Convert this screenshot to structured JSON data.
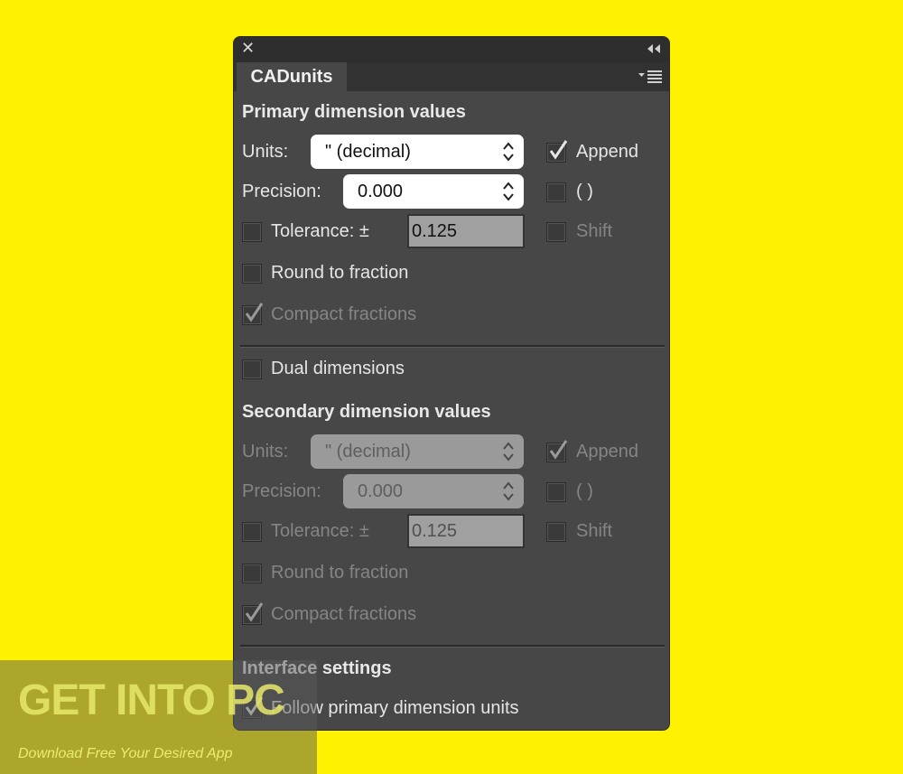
{
  "panel": {
    "tab_title": "CADunits",
    "close_glyph": "✕",
    "collapse_icon": "double-chevron-left-icon",
    "menu_icon": "panel-menu-icon"
  },
  "primary": {
    "heading": "Primary dimension values",
    "units_label": "Units:",
    "units_value": "\" (decimal)",
    "append_label": "Append",
    "append_checked": true,
    "precision_label": "Precision:",
    "precision_value": "0.000",
    "parens_label": "( )",
    "parens_checked": false,
    "tolerance_label": "Tolerance: ±",
    "tolerance_checked": false,
    "tolerance_value": "0.125",
    "shift_label": "Shift",
    "shift_checked": false,
    "round_label": "Round to fraction",
    "round_checked": false,
    "compact_label": "Compact fractions",
    "compact_checked": true
  },
  "dual": {
    "label": "Dual dimensions",
    "checked": false
  },
  "secondary": {
    "heading": "Secondary dimension values",
    "units_label": "Units:",
    "units_value": "\" (decimal)",
    "append_label": "Append",
    "append_checked": true,
    "precision_label": "Precision:",
    "precision_value": "0.000",
    "parens_label": "( )",
    "parens_checked": false,
    "tolerance_label": "Tolerance: ±",
    "tolerance_checked": false,
    "tolerance_value": "0.125",
    "shift_label": "Shift",
    "shift_checked": false,
    "round_label": "Round to fraction",
    "round_checked": false,
    "compact_label": "Compact fractions",
    "compact_checked": true
  },
  "interface": {
    "heading": "Interface settings",
    "follow_label": "Follow primary dimension units",
    "follow_checked": true
  },
  "watermark": {
    "title": "GET INTO PC",
    "subtitle": "Download Free Your Desired App"
  },
  "colors": {
    "background": "#FFF200",
    "panel": "#474747",
    "text": "#E6E6E6",
    "disabled_text": "#858585"
  }
}
